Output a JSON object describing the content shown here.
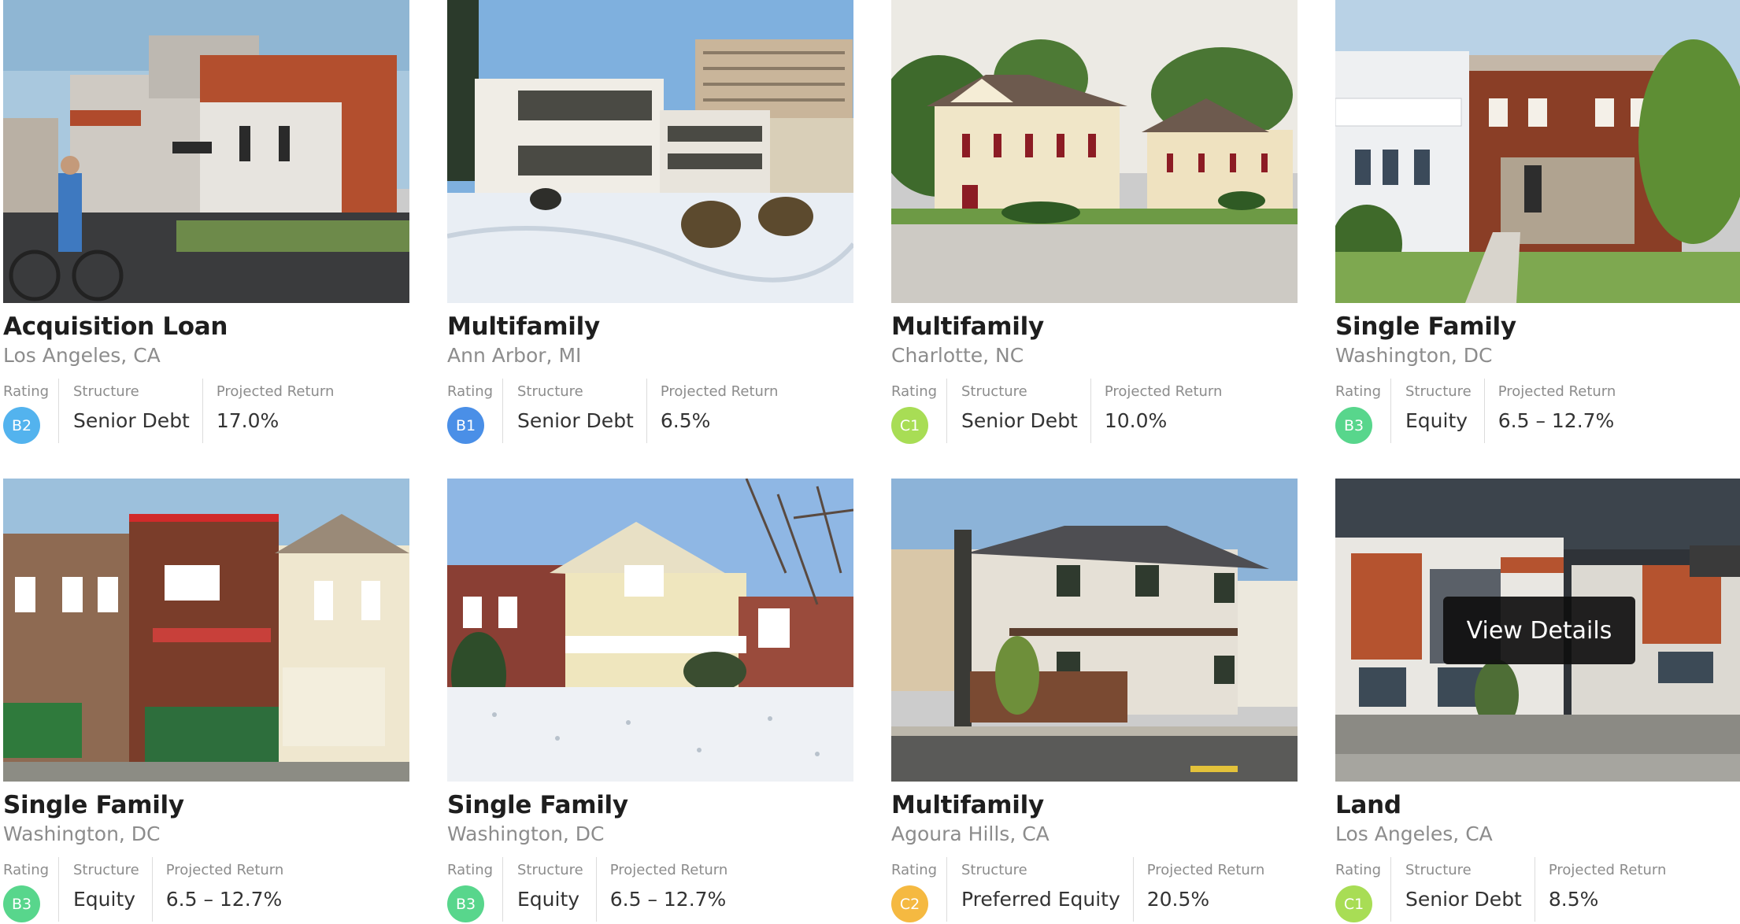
{
  "labels": {
    "rating": "Rating",
    "structure": "Structure",
    "projected_return": "Projected Return"
  },
  "view_details": "View Details",
  "rating_colors": {
    "B1": "#4a8fe7",
    "B2": "#53b3ee",
    "B3": "#58d68c",
    "C1": "#a8dd55",
    "C2": "#f5b941"
  },
  "listings": [
    {
      "type": "Acquisition Loan",
      "location": "Los Angeles, CA",
      "rating": "B2",
      "structure": "Senior Debt",
      "projected_return": "17.0%"
    },
    {
      "type": "Multifamily",
      "location": "Ann Arbor, MI",
      "rating": "B1",
      "structure": "Senior Debt",
      "projected_return": "6.5%"
    },
    {
      "type": "Multifamily",
      "location": "Charlotte, NC",
      "rating": "C1",
      "structure": "Senior Debt",
      "projected_return": "10.0%"
    },
    {
      "type": "Single Family",
      "location": "Washington, DC",
      "rating": "B3",
      "structure": "Equity",
      "projected_return": "6.5 – 12.7%"
    },
    {
      "type": "Single Family",
      "location": "Washington, DC",
      "rating": "B3",
      "structure": "Equity",
      "projected_return": "6.5 – 12.7%"
    },
    {
      "type": "Single Family",
      "location": "Washington, DC",
      "rating": "B3",
      "structure": "Equity",
      "projected_return": "6.5 – 12.7%"
    },
    {
      "type": "Multifamily",
      "location": "Agoura Hills, CA",
      "rating": "C2",
      "structure": "Preferred Equity",
      "projected_return": "20.5%"
    },
    {
      "type": "Land",
      "location": "Los Angeles, CA",
      "rating": "C1",
      "structure": "Senior Debt",
      "projected_return": "8.5%"
    }
  ]
}
